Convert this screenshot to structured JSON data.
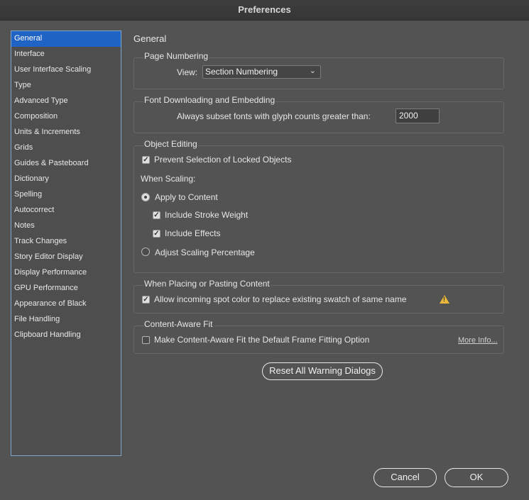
{
  "window": {
    "title": "Preferences"
  },
  "sidebar": {
    "items": [
      {
        "label": "General",
        "selected": true
      },
      {
        "label": "Interface"
      },
      {
        "label": "User Interface Scaling"
      },
      {
        "label": "Type"
      },
      {
        "label": "Advanced Type"
      },
      {
        "label": "Composition"
      },
      {
        "label": "Units & Increments"
      },
      {
        "label": "Grids"
      },
      {
        "label": "Guides & Pasteboard"
      },
      {
        "label": "Dictionary"
      },
      {
        "label": "Spelling"
      },
      {
        "label": "Autocorrect"
      },
      {
        "label": "Notes"
      },
      {
        "label": "Track Changes"
      },
      {
        "label": "Story Editor Display"
      },
      {
        "label": "Display Performance"
      },
      {
        "label": "GPU Performance"
      },
      {
        "label": "Appearance of Black"
      },
      {
        "label": "File Handling"
      },
      {
        "label": "Clipboard Handling"
      }
    ]
  },
  "main": {
    "heading": "General",
    "page_numbering": {
      "title": "Page Numbering",
      "view_label": "View:",
      "view_value": "Section Numbering"
    },
    "font_downloading": {
      "title": "Font Downloading and Embedding",
      "subset_label": "Always subset fonts with glyph counts greater than:",
      "subset_value": "2000"
    },
    "object_editing": {
      "title": "Object Editing",
      "prevent_selection_label": "Prevent Selection of Locked Objects",
      "prevent_selection_checked": true,
      "when_scaling_label": "When Scaling:",
      "apply_to_content_label": "Apply to Content",
      "apply_to_content_selected": true,
      "include_stroke_label": "Include Stroke Weight",
      "include_stroke_checked": true,
      "include_effects_label": "Include Effects",
      "include_effects_checked": true,
      "adjust_scaling_label": "Adjust Scaling Percentage",
      "adjust_scaling_selected": false
    },
    "placing": {
      "title": "When Placing or Pasting Content",
      "allow_spot_label": "Allow incoming spot color to replace existing swatch of same name",
      "allow_spot_checked": true
    },
    "content_aware": {
      "title": "Content-Aware Fit",
      "make_default_label": "Make Content-Aware Fit the Default Frame Fitting Option",
      "make_default_checked": false,
      "more_info_label": "More Info..."
    },
    "reset_warning_label": "Reset All Warning Dialogs"
  },
  "footer": {
    "cancel_label": "Cancel",
    "ok_label": "OK"
  },
  "colors": {
    "selection": "#1f63c4",
    "background": "#535353",
    "warning": "#e9b83a"
  }
}
